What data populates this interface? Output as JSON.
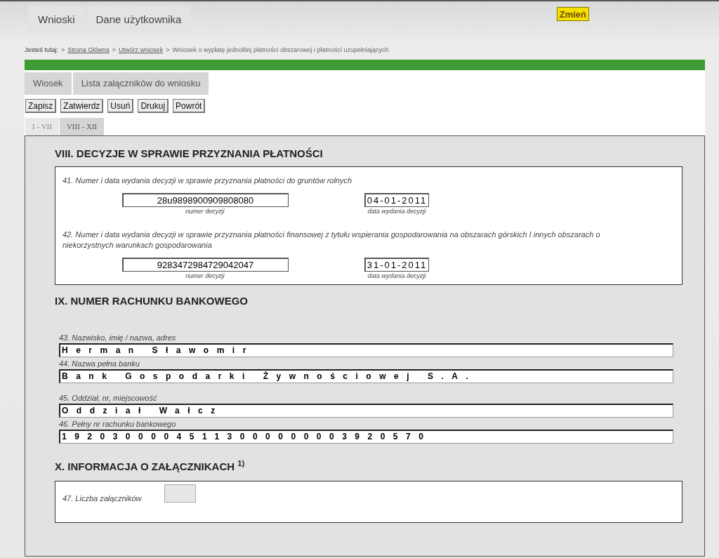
{
  "main_tabs": [
    {
      "label": "Wnioski"
    },
    {
      "label": "Dane użytkownika"
    }
  ],
  "change_button": "Zmień",
  "breadcrumb": {
    "label": "Jesteś tutaj:",
    "separator": ">",
    "items": [
      {
        "text": "Strona Główna",
        "link": true
      },
      {
        "text": "Utwórz wniosek",
        "link": true
      },
      {
        "text": "Wniosek o wypłatę jednolitej płatności obszarowej i płatności uzupełniających",
        "link": false
      }
    ]
  },
  "sub_tabs": [
    {
      "label": "Wiosek"
    },
    {
      "label": "Lista załączników do wniosku"
    }
  ],
  "toolbar": [
    "Zapisz",
    "Zatwierdz",
    "Usuń",
    "Drukuj",
    "Powrót"
  ],
  "section_tabs": [
    {
      "label": "I - VII",
      "selected": false
    },
    {
      "label": "VIII - XII",
      "selected": true
    }
  ],
  "section_viii": {
    "title": "VIII. DECYZJE W SPRAWIE PRZYZNANIA PŁATNOŚCI",
    "decisions": [
      {
        "label": "41. Numer i data wydania decyzji w sprawie przyznania płatności do gruntów rolnych",
        "number": "28u9898900909808080",
        "number_caption": "numer decyzji",
        "date": "04-01-2011",
        "date_caption": "data wydania decyzji"
      },
      {
        "label": "42. Numer i data wydania decyzji w sprawie przyznania płatności finansowej z tytułu wspierania gospodarowania na obszarach górskich I innych obszarach o niekorzystnych warunkach gospodarowania",
        "number": "9283472984729042047",
        "number_caption": "numer decyzji",
        "date": "31-01-2011",
        "date_caption": "data wydania decyzji"
      }
    ]
  },
  "section_ix": {
    "title": "IX. NUMER RACHUNKU BANKOWEGO",
    "fields": [
      {
        "label": "43. Nazwisko, imię / nazwa, adres",
        "value": "Herman Sławomir"
      },
      {
        "label": "44. Nazwa pełna banku",
        "value": "Bank Gospodarki Żywnościowej S.A."
      },
      {
        "label": "45. Oddział, nr, miejscowość",
        "value": "Oddział Wałcz"
      },
      {
        "label": "46. Pełny nr rachunku bankowego",
        "value": "19203000045113000000003920570"
      }
    ]
  },
  "section_x": {
    "title": "X. INFORMACJA O ZAŁĄCZNIKACH $^{1)}$",
    "count_label": "47. Liczba załączników"
  }
}
